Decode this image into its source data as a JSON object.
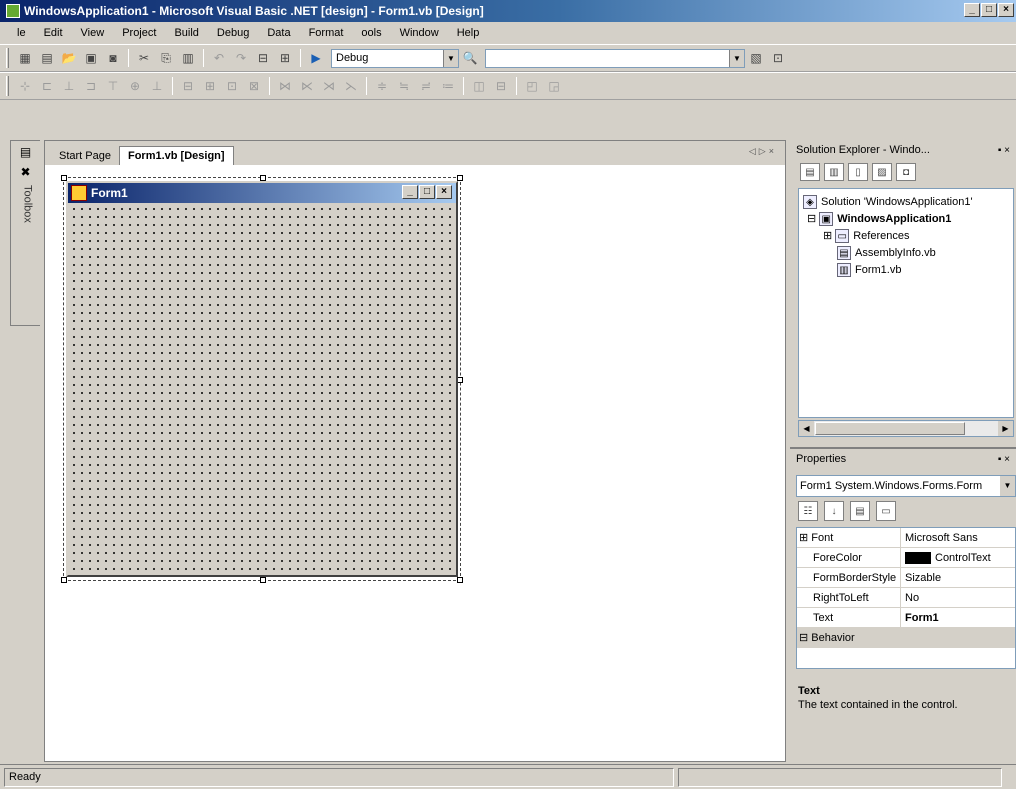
{
  "window": {
    "title": "WindowsApplication1 - Microsoft Visual Basic .NET [design] - Form1.vb [Design]"
  },
  "menubar": [
    "le",
    "Edit",
    "View",
    "Project",
    "Build",
    "Debug",
    "Data",
    "Format",
    "ools",
    "Window",
    "Help"
  ],
  "toolbar": {
    "config": "Debug"
  },
  "toolbox": {
    "label": "Toolbox"
  },
  "tabs": [
    {
      "label": "Start Page"
    },
    {
      "label": "Form1.vb [Design]"
    }
  ],
  "form": {
    "title": "Form1"
  },
  "solution_explorer": {
    "title": "Solution Explorer - Windo...",
    "items": [
      {
        "label": "Solution 'WindowsApplication1'",
        "icon": "solution-icon"
      },
      {
        "label": "WindowsApplication1",
        "icon": "project-icon"
      },
      {
        "label": "References",
        "icon": "references-icon"
      },
      {
        "label": "AssemblyInfo.vb",
        "icon": "vb-file-icon"
      },
      {
        "label": "Form1.vb",
        "icon": "form-file-icon"
      }
    ]
  },
  "properties": {
    "title": "Properties",
    "selected_object": "Form1 System.Windows.Forms.Form",
    "rows": [
      {
        "name": "Font",
        "value": "Microsoft Sans",
        "category": false,
        "expandable": true
      },
      {
        "name": "ForeColor",
        "value": "ControlText",
        "swatch": "#000000"
      },
      {
        "name": "FormBorderStyle",
        "value": "Sizable"
      },
      {
        "name": "RightToLeft",
        "value": "No"
      },
      {
        "name": "Text",
        "value": "Form1",
        "bold": true
      },
      {
        "name": "Behavior",
        "value": "",
        "category": true
      }
    ],
    "desc_title": "Text",
    "desc_body": "The text contained in the control."
  },
  "status": {
    "text": "Ready"
  }
}
